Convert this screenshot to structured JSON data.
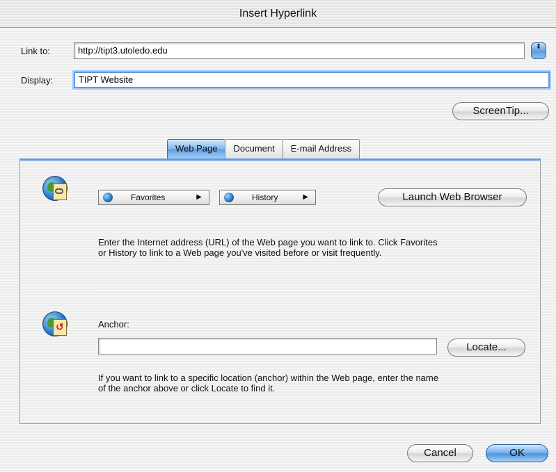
{
  "window": {
    "title": "Insert Hyperlink"
  },
  "form": {
    "link_to_label": "Link to:",
    "link_to_value": "http://tipt3.utoledo.edu",
    "display_label": "Display:",
    "display_value": "TIPT Website",
    "screentip_label": "ScreenTip...",
    "stepper_glyph": "⬍"
  },
  "tabs": [
    {
      "label": "Web Page",
      "active": true
    },
    {
      "label": "Document",
      "active": false
    },
    {
      "label": "E-mail Address",
      "active": false
    }
  ],
  "web_page": {
    "favorites_label": "Favorites",
    "history_label": "History",
    "launch_label": "Launch Web Browser",
    "description": "Enter the Internet address (URL) of the Web page you want to link to. Click Favorites or History to link to a Web page you've visited before or visit frequently.",
    "anchor_label": "Anchor:",
    "anchor_value": "",
    "locate_label": "Locate...",
    "anchor_description": "If you want to link to a specific location (anchor) within the Web page, enter the name of the anchor above or click Locate to find it.",
    "popup_arrow": "▶"
  },
  "footer": {
    "cancel_label": "Cancel",
    "ok_label": "OK"
  },
  "icons": {
    "stepper": "up-down-stepper-icon",
    "web_page": "globe-link-icon",
    "anchor": "globe-anchor-icon",
    "favorites": "globe-icon",
    "history": "globe-icon"
  },
  "colors": {
    "accent": "#5a9de2",
    "default_button": "#4f93dc",
    "focus_ring": "#a9cdf4"
  }
}
